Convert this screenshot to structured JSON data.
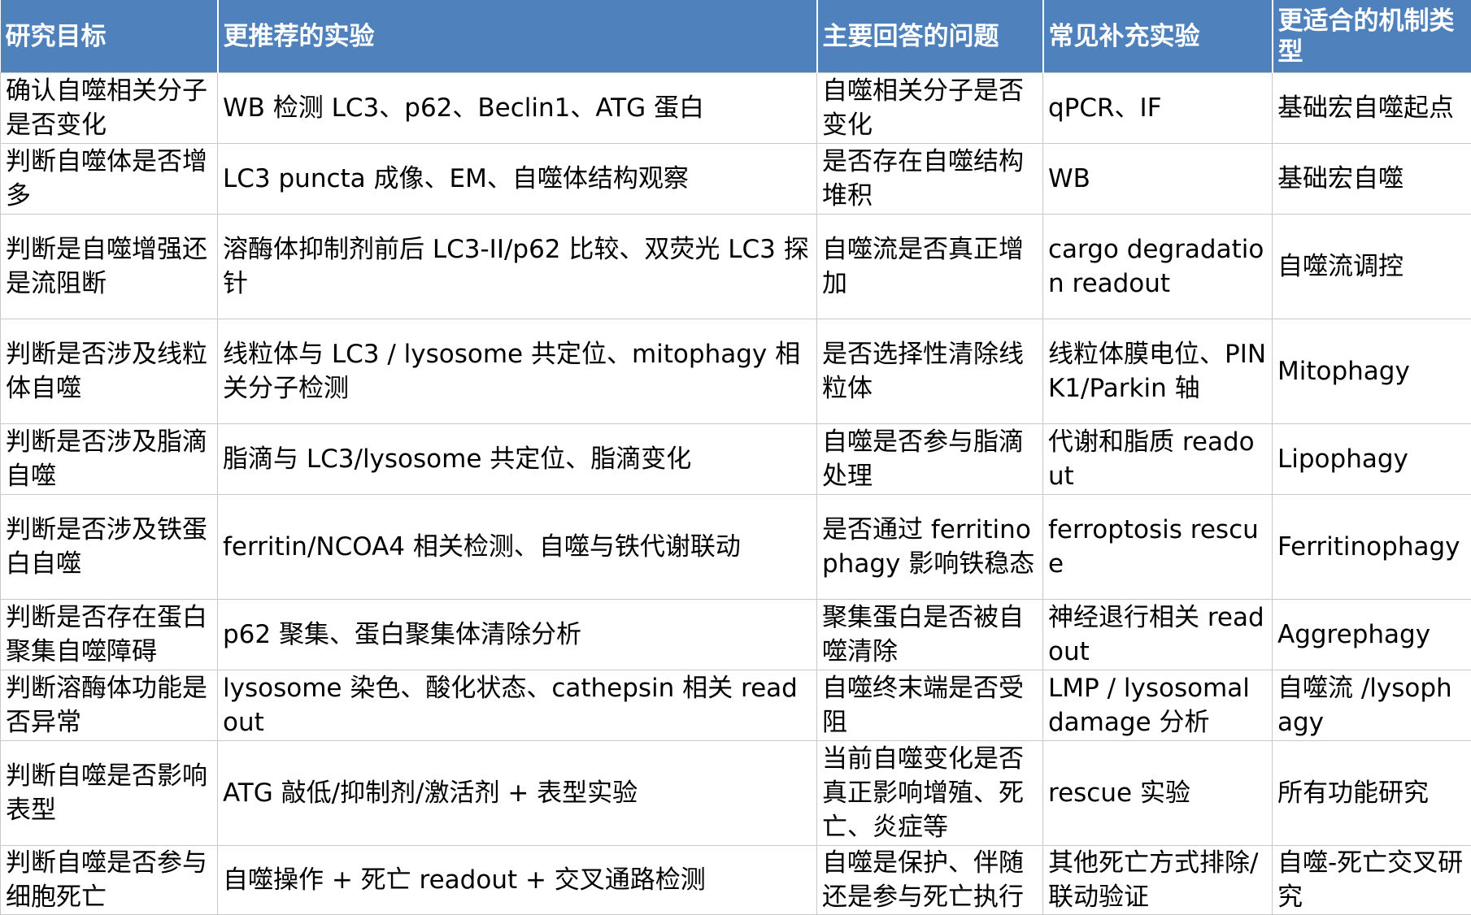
{
  "table": {
    "headers": [
      "研究目标",
      "更推荐的实验",
      "主要回答的问题",
      "常见补充实验",
      "更适合的机制类型"
    ],
    "rows": [
      [
        "确认自噬相关分子是否变化",
        "WB 检测 LC3、p62、Beclin1、ATG 蛋白",
        "自噬相关分子是否变化",
        "qPCR、IF",
        "基础宏自噬起点"
      ],
      [
        "判断自噬体是否增多",
        "LC3 puncta 成像、EM、自噬体结构观察",
        "是否存在自噬结构堆积",
        "WB",
        "基础宏自噬"
      ],
      [
        "判断是自噬增强还是流阻断",
        "溶酶体抑制剂前后 LC3-II/p62 比较、双荧光 LC3 探针",
        "自噬流是否真正增加",
        "cargo degradation readout",
        "自噬流调控"
      ],
      [
        "判断是否涉及线粒体自噬",
        "线粒体与 LC3 / lysosome 共定位、mitophagy 相关分子检测",
        "是否选择性清除线粒体",
        "线粒体膜电位、PINK1/Parkin 轴",
        "Mitophagy"
      ],
      [
        "判断是否涉及脂滴自噬",
        "脂滴与 LC3/lysosome 共定位、脂滴变化",
        "自噬是否参与脂滴处理",
        "代谢和脂质 readout",
        "Lipophagy"
      ],
      [
        "判断是否涉及铁蛋白自噬",
        "ferritin/NCOA4 相关检测、自噬与铁代谢联动",
        "是否通过 ferritinophagy 影响铁稳态",
        "ferroptosis rescue",
        "Ferritinophagy"
      ],
      [
        "判断是否存在蛋白聚集自噬障碍",
        "p62 聚集、蛋白聚集体清除分析",
        "聚集蛋白是否被自噬清除",
        "神经退行相关 readout",
        "Aggrephagy"
      ],
      [
        "判断溶酶体功能是否异常",
        "lysosome 染色、酸化状态、cathepsin 相关 readout",
        "自噬终末端是否受阻",
        "LMP / lysosomal damage 分析",
        "自噬流 /lysophagy"
      ],
      [
        "判断自噬是否影响表型",
        "ATG 敲低/抑制剂/激活剂 + 表型实验",
        "当前自噬变化是否真正影响增殖、死亡、炎症等",
        "rescue 实验",
        "所有功能研究"
      ],
      [
        "判断自噬是否参与细胞死亡",
        "自噬操作 + 死亡 readout + 交叉通路检测",
        "自噬是保护、伴随还是参与死亡执行",
        "其他死亡方式排除/联动验证",
        "自噬-死亡交叉研究"
      ]
    ]
  }
}
